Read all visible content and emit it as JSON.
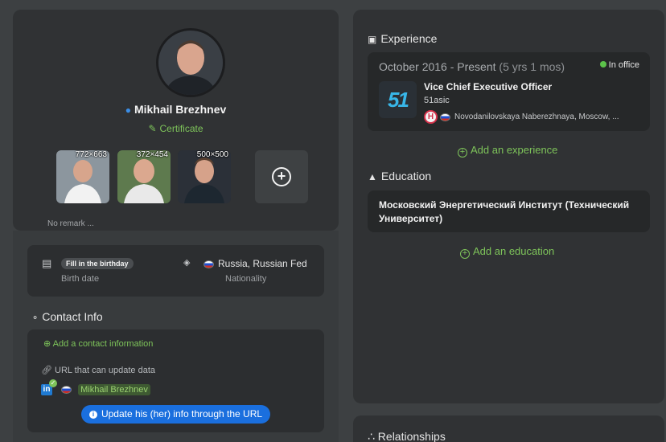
{
  "profile": {
    "name": "Mikhail Brezhnev",
    "certificate_label": "Certificate",
    "photos": [
      {
        "dimensions": "772×663"
      },
      {
        "dimensions": "372×454"
      },
      {
        "dimensions": "500×500"
      }
    ],
    "remark_placeholder": "No remark ..."
  },
  "details": {
    "birthday_action": "Fill in the birthday",
    "birthday_label": "Birth date",
    "nationality_value": "Russia, Russian Fed",
    "nationality_label": "Nationality"
  },
  "contact": {
    "title": "Contact Info",
    "add_label": "Add a contact information",
    "url_label": "URL that can update data",
    "linkedin_name": "Mikhail Brezhnev",
    "update_button": "Update his (her) info through the URL"
  },
  "experience": {
    "title": "Experience",
    "period": "October 2016 - Present",
    "duration": "(5 yrs 1 mos)",
    "status": "In office",
    "job_title": "Vice Chief Executive Officer",
    "company": "51asic",
    "company_logo_text": "51",
    "badge_letter": "H",
    "location": "Novodanilovskaya Naberezhnaya, Moscow, ...",
    "add_label": "Add an experience"
  },
  "education": {
    "title": "Education",
    "institution": "Московский Энергетический Институт (Технический Университет)",
    "add_label": "Add an education"
  },
  "relationships": {
    "title": "Relationships"
  },
  "colors": {
    "accent_green": "#7ec45a",
    "accent_blue": "#1a6fde",
    "status_green": "#5cc34a"
  }
}
